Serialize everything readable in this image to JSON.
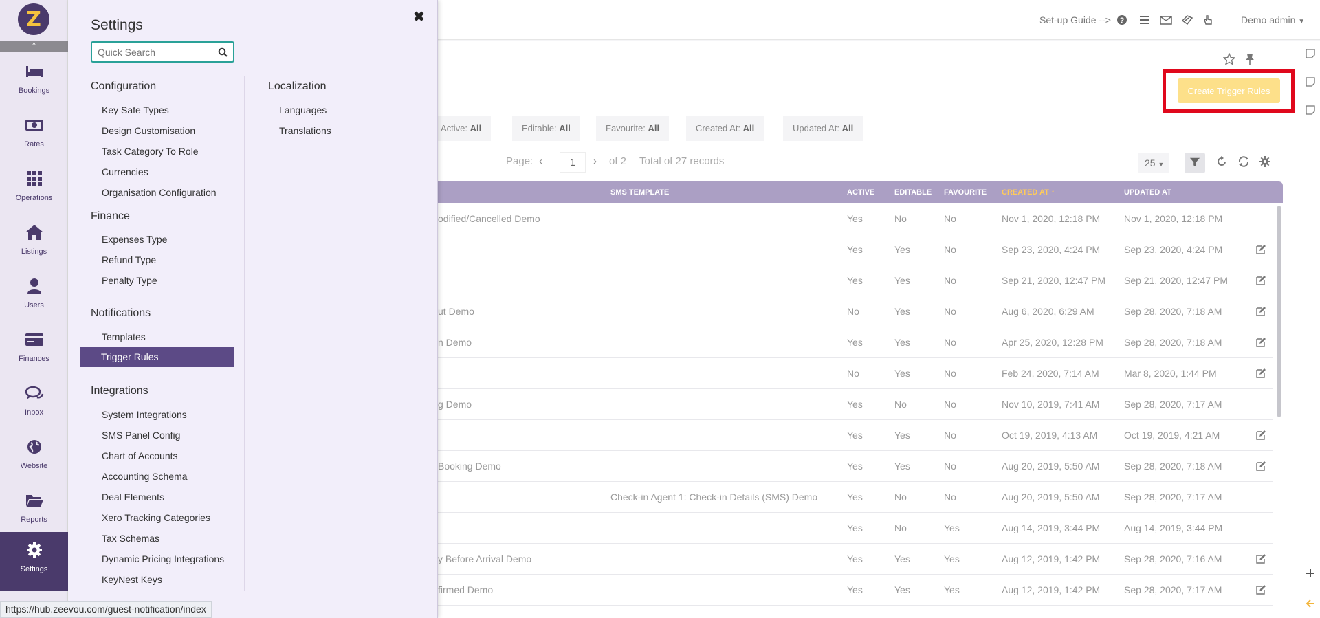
{
  "sidebar": {
    "logo_letter": "Z",
    "items": [
      {
        "label": "Bookings",
        "icon": "bed-icon"
      },
      {
        "label": "Rates",
        "icon": "money-icon"
      },
      {
        "label": "Operations",
        "icon": "grid-icon"
      },
      {
        "label": "Listings",
        "icon": "home-icon"
      },
      {
        "label": "Users",
        "icon": "user-icon"
      },
      {
        "label": "Finances",
        "icon": "credit-card-icon"
      },
      {
        "label": "Inbox",
        "icon": "chat-icon"
      },
      {
        "label": "Website",
        "icon": "globe-icon"
      },
      {
        "label": "Reports",
        "icon": "folder-icon"
      },
      {
        "label": "Settings",
        "icon": "gear-icon"
      }
    ]
  },
  "settings": {
    "title": "Settings",
    "close_glyph": "✖",
    "search_placeholder": "Quick Search",
    "configuration": {
      "title": "Configuration",
      "links": [
        "Key Safe Types",
        "Design Customisation",
        "Task Category To Role",
        "Currencies",
        "Organisation Configuration"
      ]
    },
    "finance": {
      "title": "Finance",
      "links": [
        "Expenses Type",
        "Refund Type",
        "Penalty Type"
      ]
    },
    "notifications": {
      "title": "Notifications",
      "links": [
        "Templates",
        "Trigger Rules"
      ]
    },
    "integrations": {
      "title": "Integrations",
      "links": [
        "System Integrations",
        "SMS Panel Config",
        "Chart of Accounts",
        "Accounting Schema",
        "Deal Elements",
        "Xero Tracking Categories",
        "Tax Schemas",
        "Dynamic Pricing Integrations",
        "KeyNest Keys"
      ]
    },
    "localization": {
      "title": "Localization",
      "links": [
        "Languages",
        "Translations"
      ]
    }
  },
  "topbar": {
    "guide": "Set-up Guide -->",
    "user": "Demo admin"
  },
  "main": {
    "create_button": "Create Trigger Rules",
    "filters": [
      {
        "label": "Active:",
        "value": "All"
      },
      {
        "label": "Editable:",
        "value": "All"
      },
      {
        "label": "Favourite:",
        "value": "All"
      },
      {
        "label": "Created At:",
        "value": "All"
      },
      {
        "label": "Updated At:",
        "value": "All"
      }
    ],
    "pager": {
      "label": "Page:",
      "page": "1",
      "of": "of 2",
      "total": "Total of 27 records",
      "per_page": "25"
    },
    "columns": [
      "SMS TEMPLATE",
      "ACTIVE",
      "EDITABLE",
      "FAVOURITE",
      "CREATED AT ↑",
      "UPDATED AT"
    ],
    "rows": [
      {
        "name": "odified/Cancelled Demo",
        "sms": "",
        "active": "Yes",
        "editable": "No",
        "favourite": "No",
        "created": "Nov 1, 2020, 12:18 PM",
        "updated": "Nov 1, 2020, 12:18 PM",
        "edit": false
      },
      {
        "name": "",
        "sms": "",
        "active": "Yes",
        "editable": "Yes",
        "favourite": "No",
        "created": "Sep 23, 2020, 4:24 PM",
        "updated": "Sep 23, 2020, 4:24 PM",
        "edit": true
      },
      {
        "name": "",
        "sms": "",
        "active": "Yes",
        "editable": "Yes",
        "favourite": "No",
        "created": "Sep 21, 2020, 12:47 PM",
        "updated": "Sep 21, 2020, 12:47 PM",
        "edit": true
      },
      {
        "name": "ut Demo",
        "sms": "",
        "active": "No",
        "editable": "Yes",
        "favourite": "No",
        "created": "Aug 6, 2020, 6:29 AM",
        "updated": "Sep 28, 2020, 7:18 AM",
        "edit": true
      },
      {
        "name": "n Demo",
        "sms": "",
        "active": "Yes",
        "editable": "Yes",
        "favourite": "No",
        "created": "Apr 25, 2020, 12:28 PM",
        "updated": "Sep 28, 2020, 7:18 AM",
        "edit": true
      },
      {
        "name": "",
        "sms": "",
        "active": "No",
        "editable": "Yes",
        "favourite": "No",
        "created": "Feb 24, 2020, 7:14 AM",
        "updated": "Mar 8, 2020, 1:44 PM",
        "edit": true
      },
      {
        "name": "g Demo",
        "sms": "",
        "active": "Yes",
        "editable": "No",
        "favourite": "No",
        "created": "Nov 10, 2019, 7:41 AM",
        "updated": "Sep 28, 2020, 7:17 AM",
        "edit": false
      },
      {
        "name": "",
        "sms": "",
        "active": "Yes",
        "editable": "Yes",
        "favourite": "No",
        "created": "Oct 19, 2019, 4:13 AM",
        "updated": "Oct 19, 2019, 4:21 AM",
        "edit": true
      },
      {
        "name": "Booking Demo",
        "sms": "",
        "active": "Yes",
        "editable": "Yes",
        "favourite": "No",
        "created": "Aug 20, 2019, 5:50 AM",
        "updated": "Sep 28, 2020, 7:18 AM",
        "edit": true
      },
      {
        "name": "",
        "sms": "Check-in Agent 1: Check-in Details (SMS) Demo",
        "active": "Yes",
        "editable": "No",
        "favourite": "No",
        "created": "Aug 20, 2019, 5:50 AM",
        "updated": "Sep 28, 2020, 7:17 AM",
        "edit": false
      },
      {
        "name": "",
        "sms": "",
        "active": "Yes",
        "editable": "No",
        "favourite": "Yes",
        "created": "Aug 14, 2019, 3:44 PM",
        "updated": "Aug 14, 2019, 3:44 PM",
        "edit": false
      },
      {
        "name": "y Before Arrival Demo",
        "sms": "",
        "active": "Yes",
        "editable": "Yes",
        "favourite": "Yes",
        "created": "Aug 12, 2019, 1:42 PM",
        "updated": "Sep 28, 2020, 7:16 AM",
        "edit": true
      },
      {
        "name": "firmed Demo",
        "sms": "",
        "active": "Yes",
        "editable": "Yes",
        "favourite": "Yes",
        "created": "Aug 12, 2019, 1:42 PM",
        "updated": "Sep 28, 2020, 7:17 AM",
        "edit": true
      }
    ]
  },
  "statusbar": {
    "url": "https://hub.zeevou.com/guest-notification/index"
  },
  "colors": {
    "brand": "#4a3a6b",
    "accent": "#f5c23e",
    "highlight": "#e0081c",
    "header": "#ab9fc4"
  }
}
